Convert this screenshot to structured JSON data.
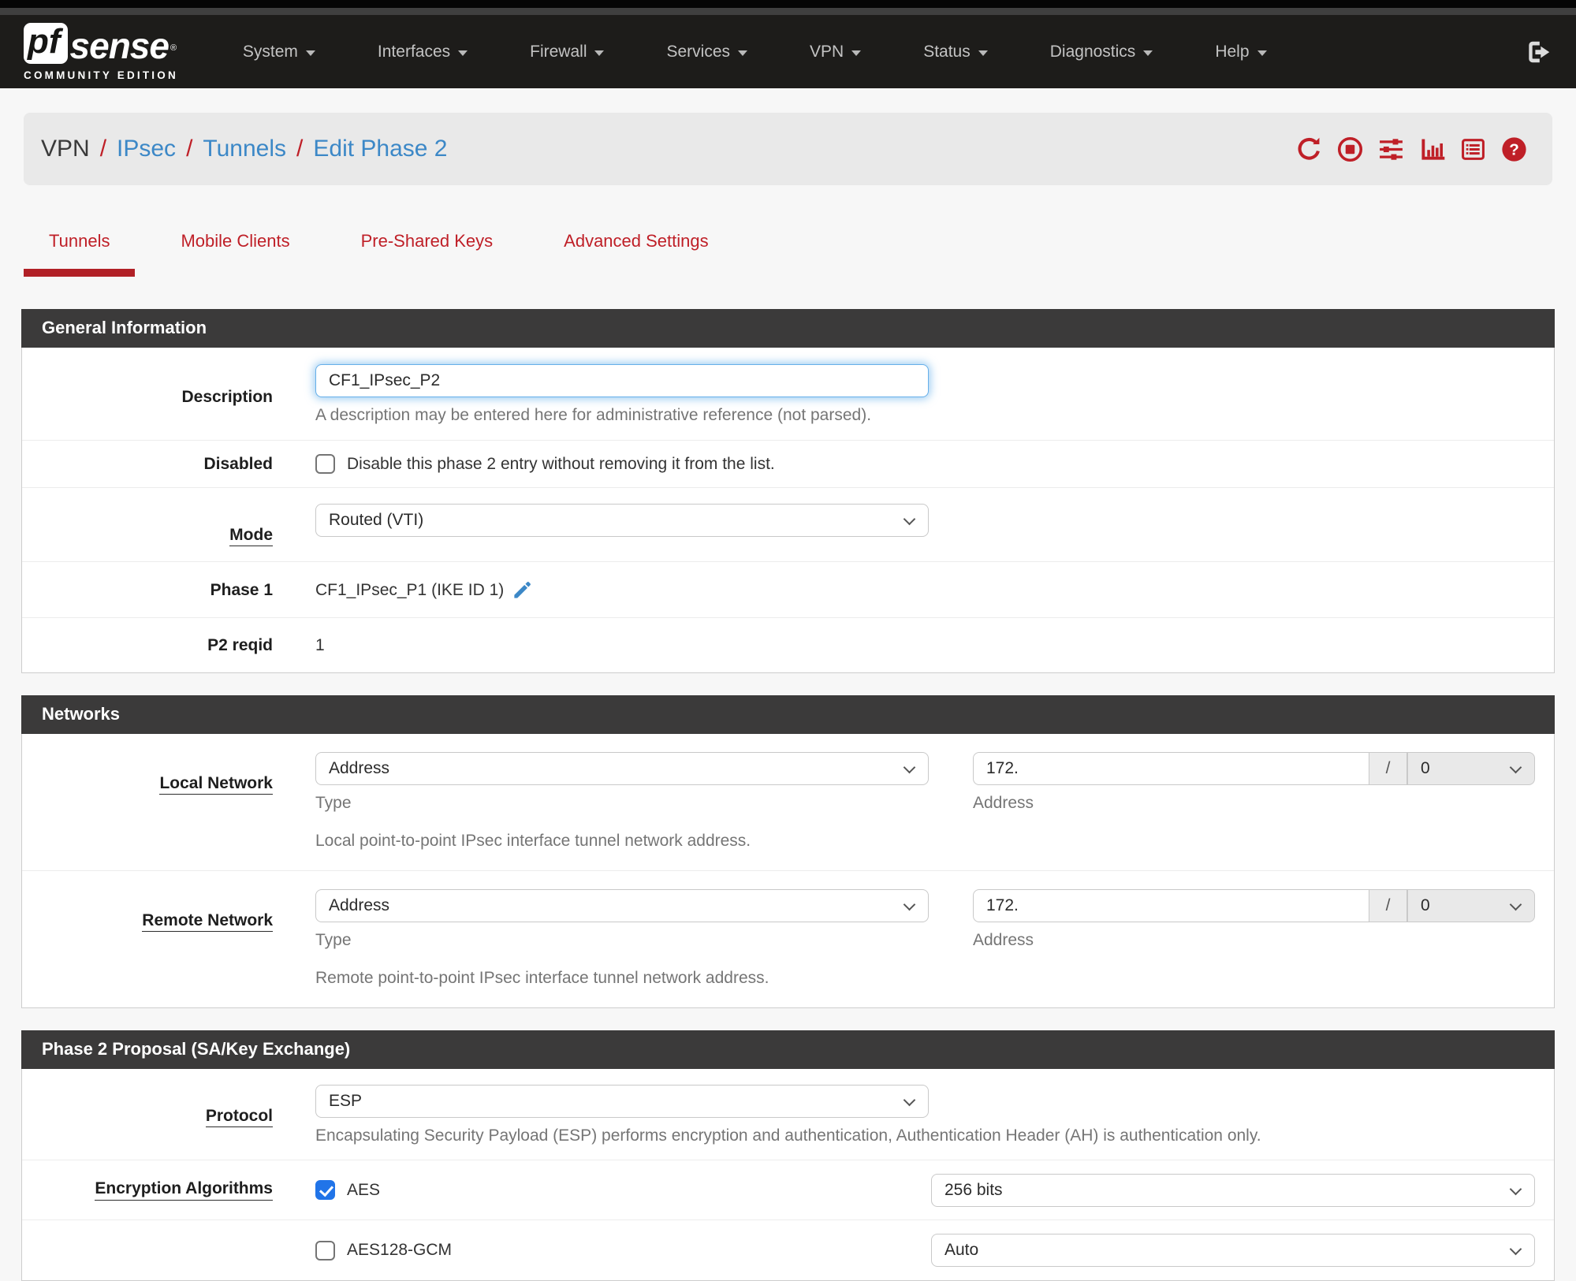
{
  "colors": {
    "accent_red": "#bf1f27",
    "link_blue": "#3c88c7",
    "checkbox_blue": "#2174e8",
    "panel_header_bg": "#3b3a3a",
    "navbar_bg": "#1d1c1a",
    "input_focus": "#66afe9"
  },
  "navbar": {
    "brand": {
      "pf": "pf",
      "sense": "sense",
      "reg": "®",
      "edition": "COMMUNITY EDITION"
    },
    "items": [
      {
        "label": "System"
      },
      {
        "label": "Interfaces"
      },
      {
        "label": "Firewall"
      },
      {
        "label": "Services"
      },
      {
        "label": "VPN"
      },
      {
        "label": "Status"
      },
      {
        "label": "Diagnostics"
      },
      {
        "label": "Help"
      }
    ]
  },
  "breadcrumb": {
    "separator": "/",
    "items": [
      {
        "label": "VPN"
      },
      {
        "label": "IPsec"
      },
      {
        "label": "Tunnels"
      },
      {
        "label": "Edit Phase 2"
      }
    ]
  },
  "crumb_icons": [
    {
      "name": "refresh"
    },
    {
      "name": "stop"
    },
    {
      "name": "sliders"
    },
    {
      "name": "chart"
    },
    {
      "name": "log"
    },
    {
      "name": "help"
    }
  ],
  "tabs": [
    {
      "label": "Tunnels",
      "active": true
    },
    {
      "label": "Mobile Clients",
      "active": false
    },
    {
      "label": "Pre-Shared Keys",
      "active": false
    },
    {
      "label": "Advanced Settings",
      "active": false
    }
  ],
  "panels": {
    "general": {
      "title": "General Information",
      "description": {
        "label": "Description",
        "value": "CF1_IPsec_P2",
        "help": "A description may be entered here for administrative reference (not parsed)."
      },
      "disabled": {
        "label": "Disabled",
        "checked": false,
        "checkbox_label": "Disable this phase 2 entry without removing it from the list."
      },
      "mode": {
        "label": "Mode",
        "value": "Routed (VTI)"
      },
      "phase1": {
        "label": "Phase 1",
        "value": "CF1_IPsec_P1 (IKE ID 1)"
      },
      "p2reqid": {
        "label": "P2 reqid",
        "value": "1"
      }
    },
    "networks": {
      "title": "Networks",
      "local": {
        "label": "Local Network",
        "type_value": "Address",
        "type_help": "Type",
        "address_value": "172.",
        "address_help": "Address",
        "separator": "/",
        "prefix_value": "0",
        "help": "Local point-to-point IPsec interface tunnel network address."
      },
      "remote": {
        "label": "Remote Network",
        "type_value": "Address",
        "type_help": "Type",
        "address_value": "172.",
        "address_help": "Address",
        "separator": "/",
        "prefix_value": "0",
        "help": "Remote point-to-point IPsec interface tunnel network address."
      }
    },
    "proposal": {
      "title": "Phase 2 Proposal (SA/Key Exchange)",
      "protocol": {
        "label": "Protocol",
        "value": "ESP",
        "help": "Encapsulating Security Payload (ESP) performs encryption and authentication, Authentication Header (AH) is authentication only."
      },
      "encryption": {
        "label": "Encryption Algorithms",
        "rows": [
          {
            "name": "AES",
            "checked": true,
            "keylen": "256 bits"
          },
          {
            "name": "AES128-GCM",
            "checked": false,
            "keylen": "Auto"
          }
        ]
      }
    }
  }
}
